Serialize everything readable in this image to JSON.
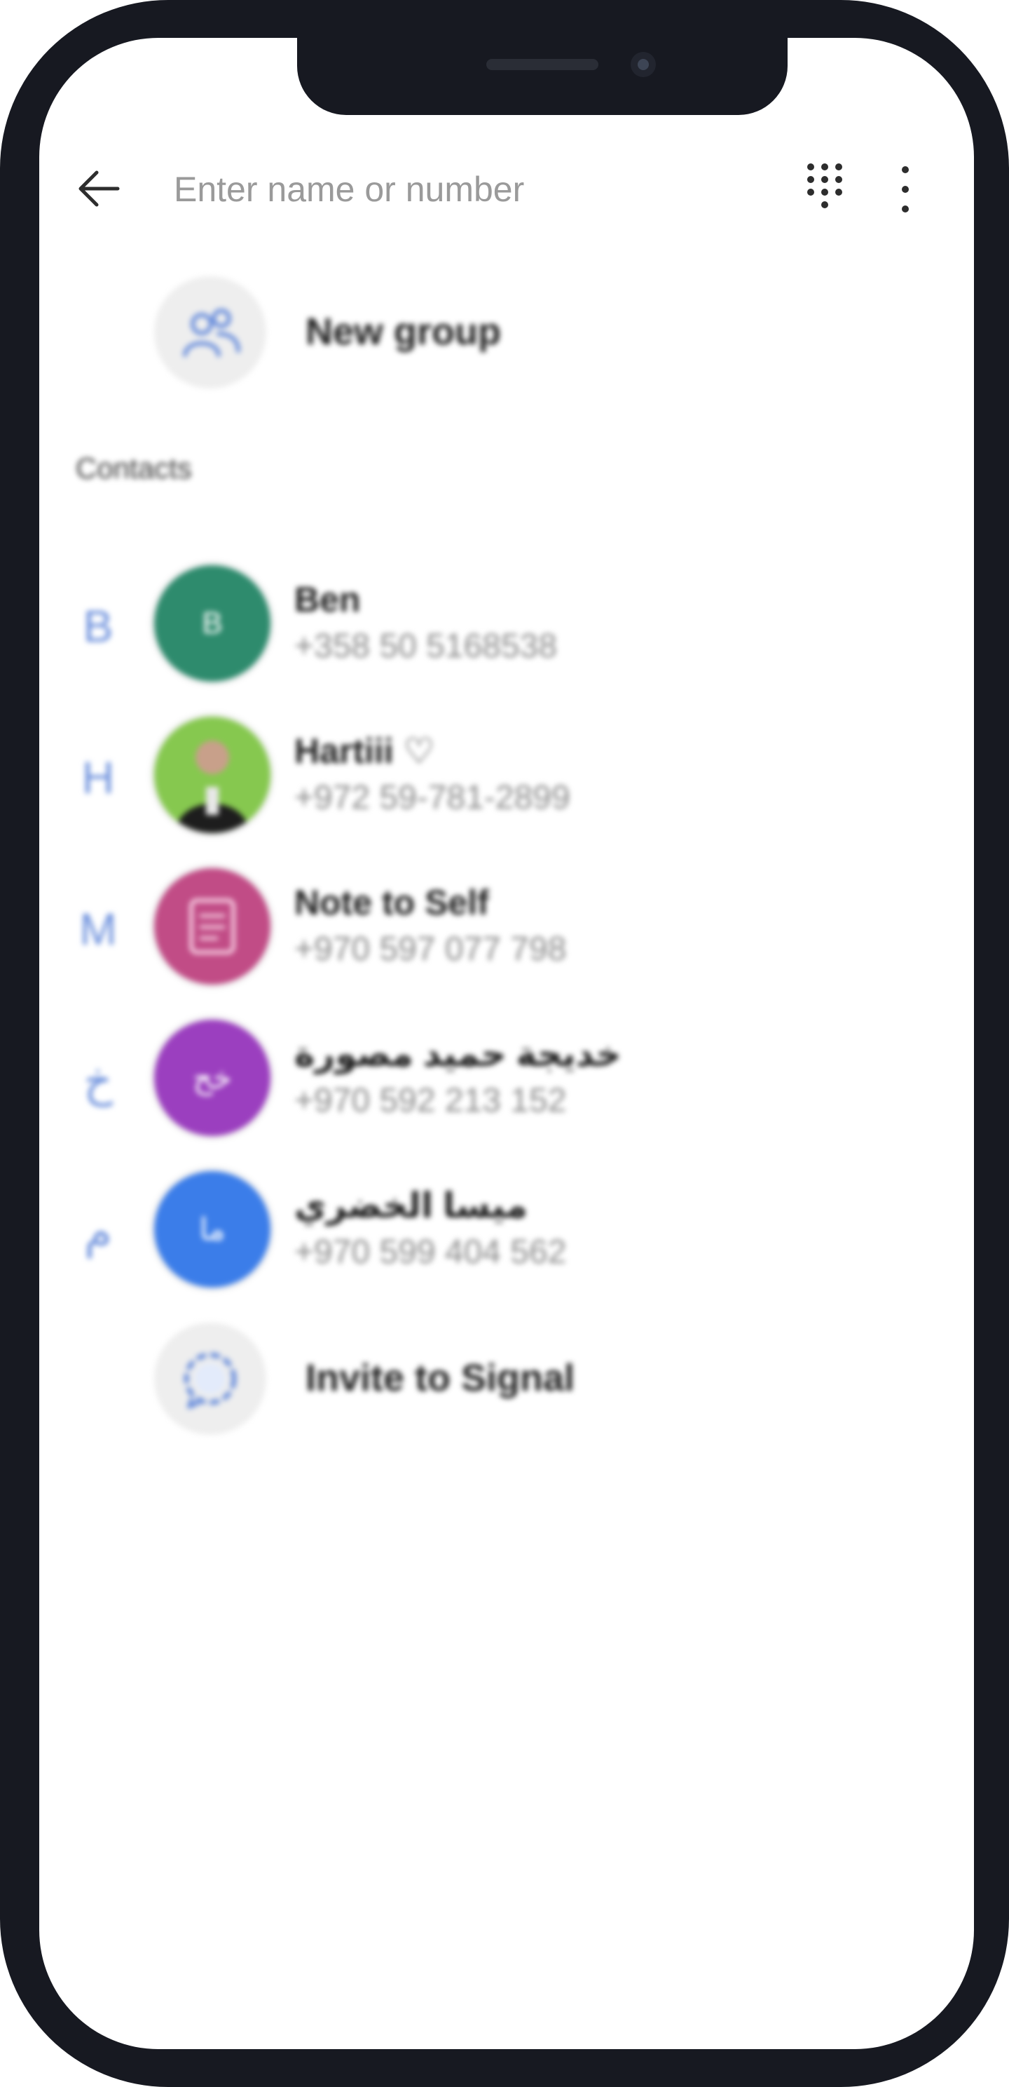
{
  "search": {
    "placeholder": "Enter name or number"
  },
  "icons": {
    "back": "arrow-left-icon",
    "dialpad": "dialpad-icon",
    "more": "more-vertical-icon",
    "new_group": "group-add-icon",
    "invite": "signal-chat-icon"
  },
  "new_group": {
    "label": "New group"
  },
  "section": {
    "label": "Contacts"
  },
  "contacts": [
    {
      "letter": "B",
      "initial": "B",
      "name": "Ben",
      "phone": "+358 50 5168538",
      "color": "#2e8b6d"
    },
    {
      "letter": "H",
      "initial": "",
      "name": "Hartiii ♡",
      "phone": "+972 59-781-2899",
      "color": "#7cc44a"
    },
    {
      "letter": "M",
      "initial": "",
      "name": "Note to Self",
      "phone": "+970 597 077 798",
      "color": "#c14c86"
    },
    {
      "letter": "خ",
      "initial": "خح",
      "name": "خديجة حميد مصورة",
      "phone": "+970 592 213 152",
      "color": "#9b3fbf"
    },
    {
      "letter": "م",
      "initial": "ما",
      "name": "ميسا الخضري",
      "phone": "+970 599 404 562",
      "color": "#3b7de9"
    }
  ],
  "invite": {
    "label": "Invite to Signal"
  },
  "colors": {
    "frame": "#171921",
    "accent": "#6b8fdc"
  }
}
